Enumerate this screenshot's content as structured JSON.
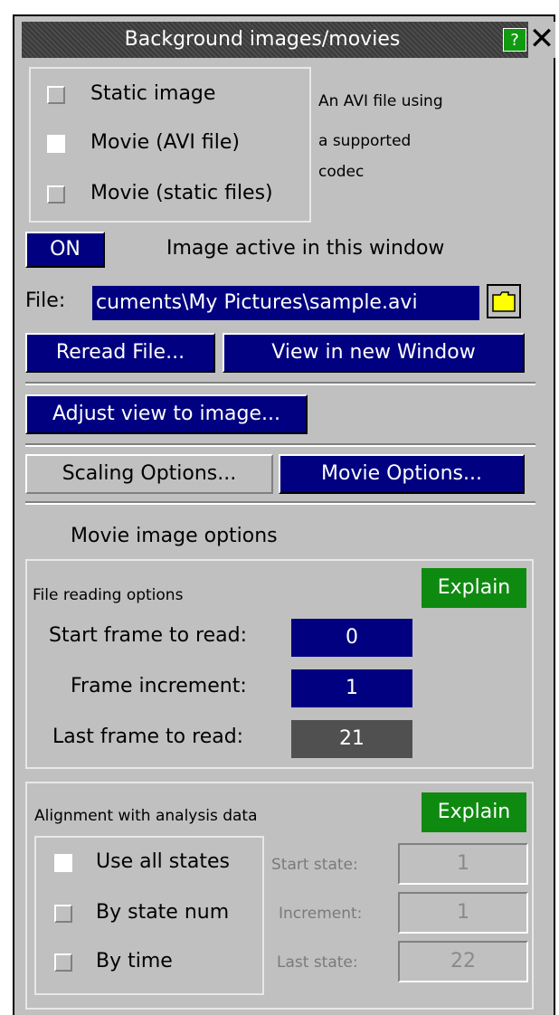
{
  "window": {
    "title": "Background images/movies",
    "help_label": "?",
    "close_label": "✕"
  },
  "source_type": {
    "options": [
      "Static image",
      "Movie (AVI file)",
      "Movie (static files)"
    ],
    "selected": "Movie (AVI file)",
    "description_lines": [
      "An AVI file using",
      "a supported",
      "codec"
    ]
  },
  "active": {
    "toggle_label": "ON",
    "label": "Image active in this window"
  },
  "file": {
    "label": "File:",
    "value": "cuments\\My Pictures\\sample.avi"
  },
  "buttons": {
    "reread": "Reread File...",
    "view_new_window": "View in new Window",
    "adjust_view": "Adjust view to image...",
    "scaling_options": "Scaling Options...",
    "movie_options": "Movie Options..."
  },
  "movie_options": {
    "heading": "Movie image options",
    "file_reading": {
      "heading": "File reading options",
      "explain_label": "Explain",
      "rows": [
        {
          "label": "Start frame to read:",
          "value": "0"
        },
        {
          "label": "Frame increment:",
          "value": "1"
        },
        {
          "label": "Last frame to read:",
          "value": "21"
        }
      ]
    },
    "alignment": {
      "heading": "Alignment with analysis data",
      "explain_label": "Explain",
      "options": [
        "Use all states",
        "By state num",
        "By time"
      ],
      "selected": "Use all states",
      "fields": [
        {
          "label": "Start state:",
          "value": "1"
        },
        {
          "label": "Increment:",
          "value": "1"
        },
        {
          "label": "Last state:",
          "value": "22"
        }
      ]
    }
  },
  "colors": {
    "panel": "#c0c0c0",
    "button_blue": "#000080",
    "explain_green": "#0f8a10",
    "readonly_field": "#505050"
  }
}
